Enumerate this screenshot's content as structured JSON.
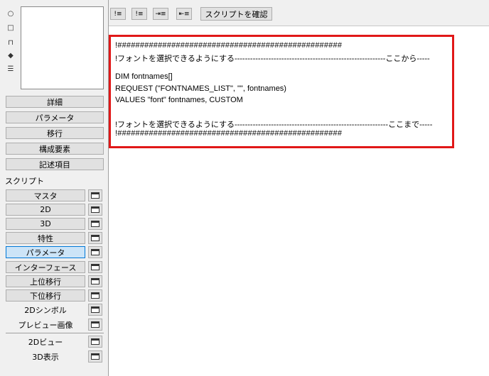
{
  "left_panel": {
    "tool_icons": [
      "circle-icon",
      "square-icon",
      "stamp-icon",
      "cube-icon",
      "list-icon"
    ],
    "section_buttons": [
      "詳細",
      "パラメータ",
      "移行",
      "構成要素",
      "記述項目"
    ],
    "script_label": "スクリプト",
    "script_buttons": [
      "マスタ",
      "2D",
      "3D",
      "特性",
      "パラメータ",
      "インターフェース",
      "上位移行",
      "下位移行",
      "2Dシンボル",
      "プレビュー画像",
      "2Dビュー",
      "3D表示"
    ],
    "active_script": "パラメータ"
  },
  "toolbar": {
    "check_button": "スクリプトを確認",
    "icons": [
      "insert-comment-icon",
      "remove-comment-icon",
      "indent-icon",
      "outdent-icon"
    ]
  },
  "editor": {
    "lines": [
      "!##################################################",
      "!フォントを選択できるようにする----------------------------------------------------------ここから-----",
      "",
      "DIM fontnames[]",
      "REQUEST (\"FONTNAMES_LIST\", \"\", fontnames)",
      "VALUES \"font\" fontnames, CUSTOM",
      "",
      "!フォントを選択できるようにする-----------------------------------------------------------ここまで-----",
      "!##################################################"
    ],
    "highlight_color": "#e11818"
  }
}
